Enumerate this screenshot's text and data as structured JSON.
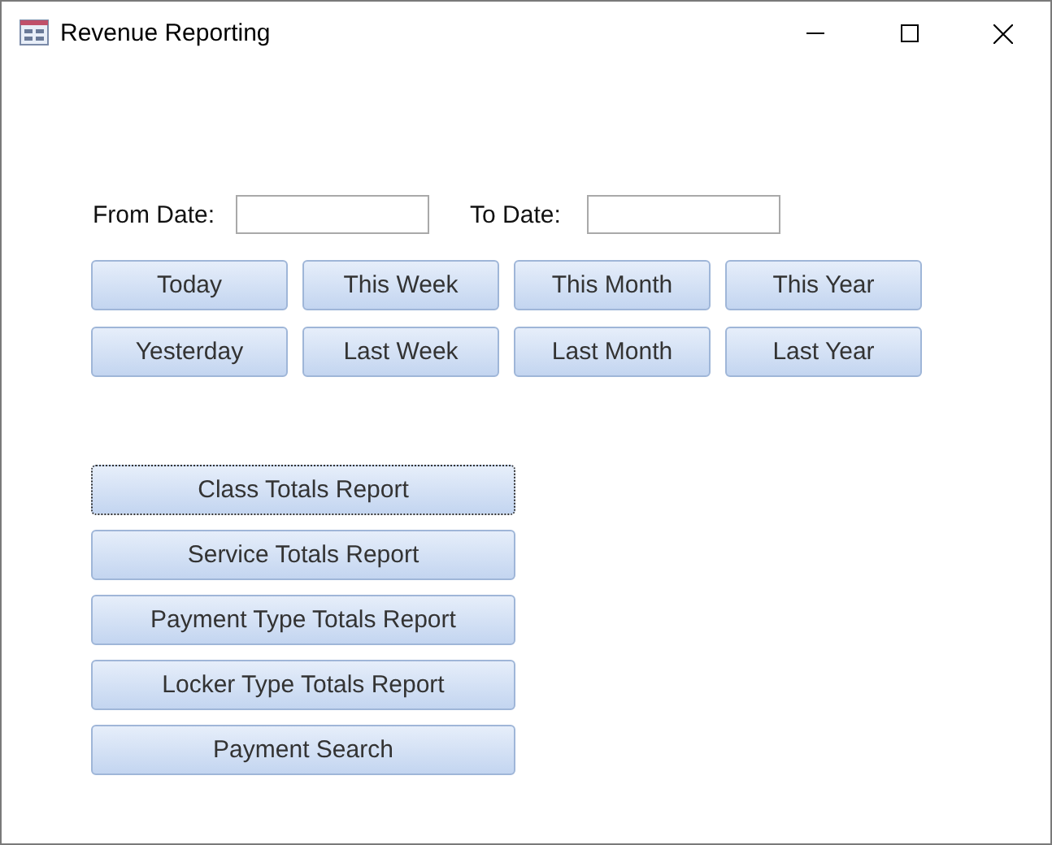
{
  "window": {
    "title": "Revenue Reporting"
  },
  "date_fields": [
    {
      "label": "From Date:"
    },
    {
      "label": "To Date:"
    }
  ],
  "range_buttons": [
    {
      "label": "Today"
    },
    {
      "label": "This Week"
    },
    {
      "label": "This Month"
    },
    {
      "label": "This Year"
    },
    {
      "label": "Yesterday"
    },
    {
      "label": "Last Week"
    },
    {
      "label": "Last Month"
    },
    {
      "label": "Last Year"
    }
  ],
  "report_buttons": [
    {
      "label": "Class Totals Report",
      "focused": true
    },
    {
      "label": "Service Totals Report",
      "focused": false
    },
    {
      "label": "Payment Type Totals Report",
      "focused": false
    },
    {
      "label": "Locker Type Totals Report",
      "focused": false
    },
    {
      "label": "Payment Search",
      "focused": false
    }
  ]
}
